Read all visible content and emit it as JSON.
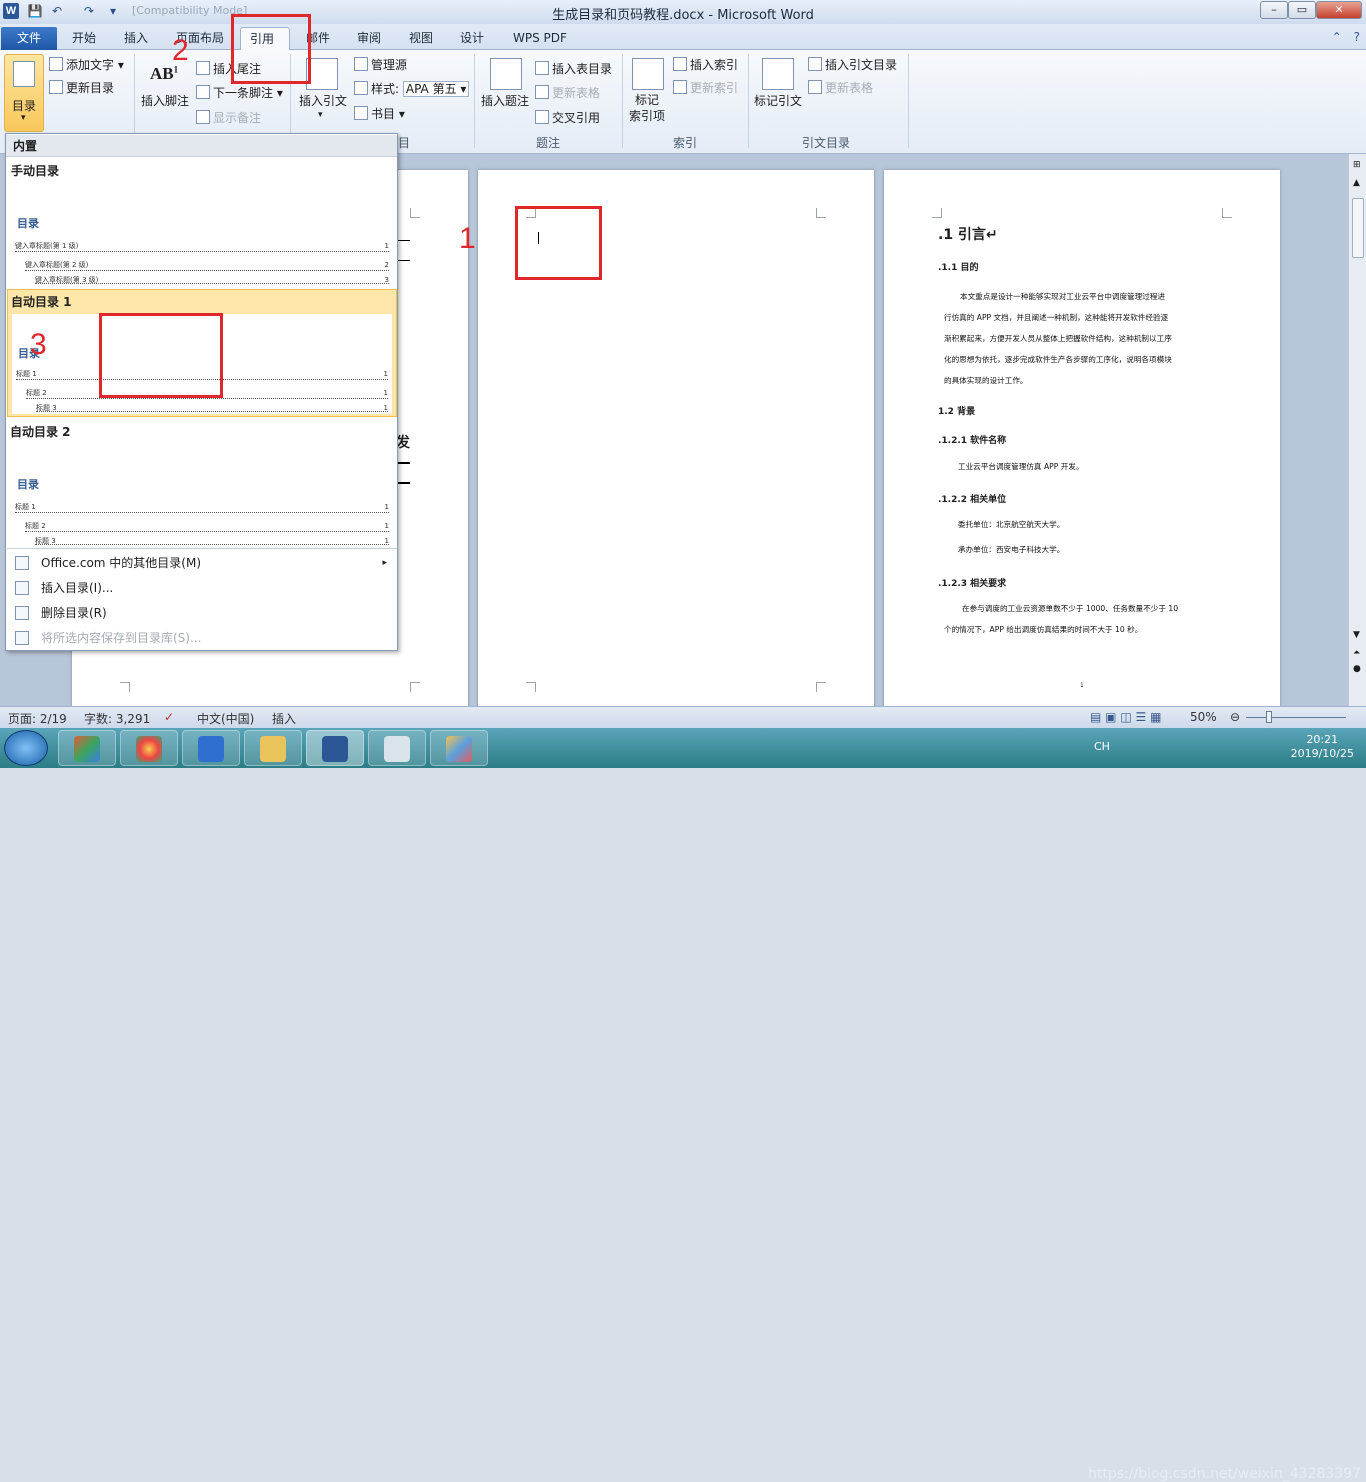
{
  "window": {
    "ghost_title": "[Compatibility Mode]",
    "title": "生成目录和页码教程.docx - Microsoft Word",
    "minimize": "–",
    "maximize": "▭",
    "close": "✕"
  },
  "quick_access": {
    "save_icon": "save-icon",
    "undo_icon": "undo-icon",
    "redo_icon": "redo-icon"
  },
  "tabs": [
    {
      "label": "文件"
    },
    {
      "label": "开始"
    },
    {
      "label": "插入"
    },
    {
      "label": "页面布局"
    },
    {
      "label": "引用"
    },
    {
      "label": "邮件"
    },
    {
      "label": "审阅"
    },
    {
      "label": "视图"
    },
    {
      "label": "设计"
    },
    {
      "label": "WPS PDF"
    }
  ],
  "ribbon": {
    "toc_group": {
      "toc": "目录",
      "add_text": "添加文字",
      "update_toc": "更新目录"
    },
    "footnotes_group": {
      "insert_footnote": "插入脚注",
      "insert_endnote": "插入尾注",
      "next_footnote": "下一条脚注",
      "show_notes": "显示备注"
    },
    "citations_group": {
      "insert_citation": "插入引文",
      "manage_sources": "管理源",
      "style_label": "样式:",
      "style_value": "APA 第五",
      "bibliography": "书目",
      "label_tail": "目"
    },
    "captions_group": {
      "insert_caption": "插入题注",
      "insert_table_of_figures": "插入表目录",
      "update_table": "更新表格",
      "cross_reference": "交叉引用",
      "label": "题注"
    },
    "index_group": {
      "mark_entry": "标记\n索引项",
      "insert_index": "插入索引",
      "update_index": "更新索引",
      "label": "索引"
    },
    "toa_group": {
      "mark_citation": "标记引文",
      "insert_toa": "插入引文目录",
      "update_table": "更新表格",
      "label": "引文目录"
    }
  },
  "toc_gallery": {
    "header": "内置",
    "manual_title": "手动目录",
    "manual_preview": {
      "title": "目录",
      "line1": "键入章标题(第 1 级)",
      "line2": "键入章标题(第 2 级)",
      "line3": "键入章标题(第 3 级)",
      "p1": "1",
      "p2": "2",
      "p3": "3"
    },
    "auto1_title": "自动目录 1",
    "auto1_preview": {
      "title": "目录",
      "line1": "标题 1",
      "line2": "标题 2",
      "line3": "标题 3",
      "p": "1"
    },
    "auto2_title": "自动目录 2",
    "auto2_preview": {
      "title": "目录",
      "line1": "标题 1",
      "line2": "标题 2",
      "line3": "标题 3",
      "p": "1"
    },
    "more": "Office.com 中的其他目录(M)",
    "insert": "插入目录(I)...",
    "remove": "删除目录(R)",
    "save_selection": "将所选内容保存到目录库(S)..."
  },
  "document": {
    "page3": {
      "h1": ".1 引言↵",
      "h_goal": ".1.1 目的",
      "goal_lines": [
        "本文重点是设计一种能够实现对工业云平台中调度管理过程进",
        "行仿真的 APP 文档，并且阐述一种机制，这种能将开发软件经验逐",
        "渐积累起来，方便开发人员从整体上把握软件结构，这种机制以工序",
        "化的思想为依托，逐步完成软件生产各步骤的工序化，说明各项模块",
        "的具体实现的设计工作。"
      ],
      "h_background": "1.2 背景",
      "h_name": ".1.2.1 软件名称",
      "name_text": "工业云平台调度管理仿真 APP 开发。",
      "h_units": ".1.2.2 相关单位",
      "units_1": "委托单位：北京航空航天大学。",
      "units_2": "承办单位：西安电子科技大学。",
      "h_requirements": ".1.2.3 相关要求",
      "req_lines": [
        "在参与调度的工业云资源单数不少于 1000、任务数量不少于 10",
        "个的情况下，APP 给出调度仿真结果的时间不大于  10 秒。"
      ],
      "page_number": "1"
    },
    "page1_fragment": "发"
  },
  "annotations": {
    "n1": "1",
    "n2": "2",
    "n3": "3"
  },
  "statusbar": {
    "page": "页面: 2/19",
    "words": "字数: 3,291",
    "language": "中文(中国)",
    "mode": "插入",
    "zoom": "50%"
  },
  "taskbar": {
    "time": "20:21",
    "date": "2019/10/25",
    "watermark": "https://blog.csdn.net/weixin_43283397",
    "lang": "CH"
  }
}
